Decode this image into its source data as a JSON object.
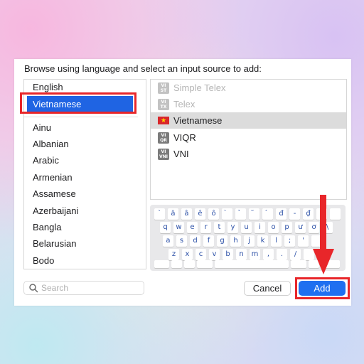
{
  "dialog": {
    "prompt": "Browse using language and select an input source to add:"
  },
  "languages": {
    "top": "English",
    "selected": "Vietnamese",
    "items": [
      "Ainu",
      "Albanian",
      "Arabic",
      "Armenian",
      "Assamese",
      "Azerbaijani",
      "Bangla",
      "Belarusian",
      "Bodo"
    ]
  },
  "sources": [
    {
      "badge_top": "VI",
      "badge_bottom": "ST",
      "label": "Simple Telex",
      "disabled": true
    },
    {
      "badge_top": "VI",
      "badge_bottom": "TX",
      "label": "Telex",
      "disabled": true
    },
    {
      "badge_top": "",
      "badge_bottom": "",
      "label": "Vietnamese",
      "selected": true,
      "icon": "vietnam-flag"
    },
    {
      "badge_top": "VI",
      "badge_bottom": "QR",
      "label": "VIQR"
    },
    {
      "badge_top": "VI",
      "badge_bottom": "VNI",
      "label": "VNI"
    }
  ],
  "keyboard": {
    "rows": [
      [
        "`",
        "ă",
        "â",
        "ê",
        "ô",
        "̀",
        "̉",
        "̃",
        "́",
        "đ",
        "-",
        "₫"
      ],
      [
        "q",
        "w",
        "e",
        "r",
        "t",
        "y",
        "u",
        "i",
        "o",
        "p",
        "ư",
        "ơ",
        "\\"
      ],
      [
        "a",
        "s",
        "d",
        "f",
        "g",
        "h",
        "j",
        "k",
        "l",
        ";",
        "'"
      ],
      [
        "z",
        "x",
        "c",
        "v",
        "b",
        "n",
        "m",
        ",",
        ".",
        "/"
      ]
    ]
  },
  "search": {
    "placeholder": "Search",
    "value": ""
  },
  "buttons": {
    "cancel": "Cancel",
    "add": "Add"
  },
  "colors": {
    "accent": "#1f6ff0",
    "highlight": "#e8262a",
    "selection": "#1f64e3"
  }
}
